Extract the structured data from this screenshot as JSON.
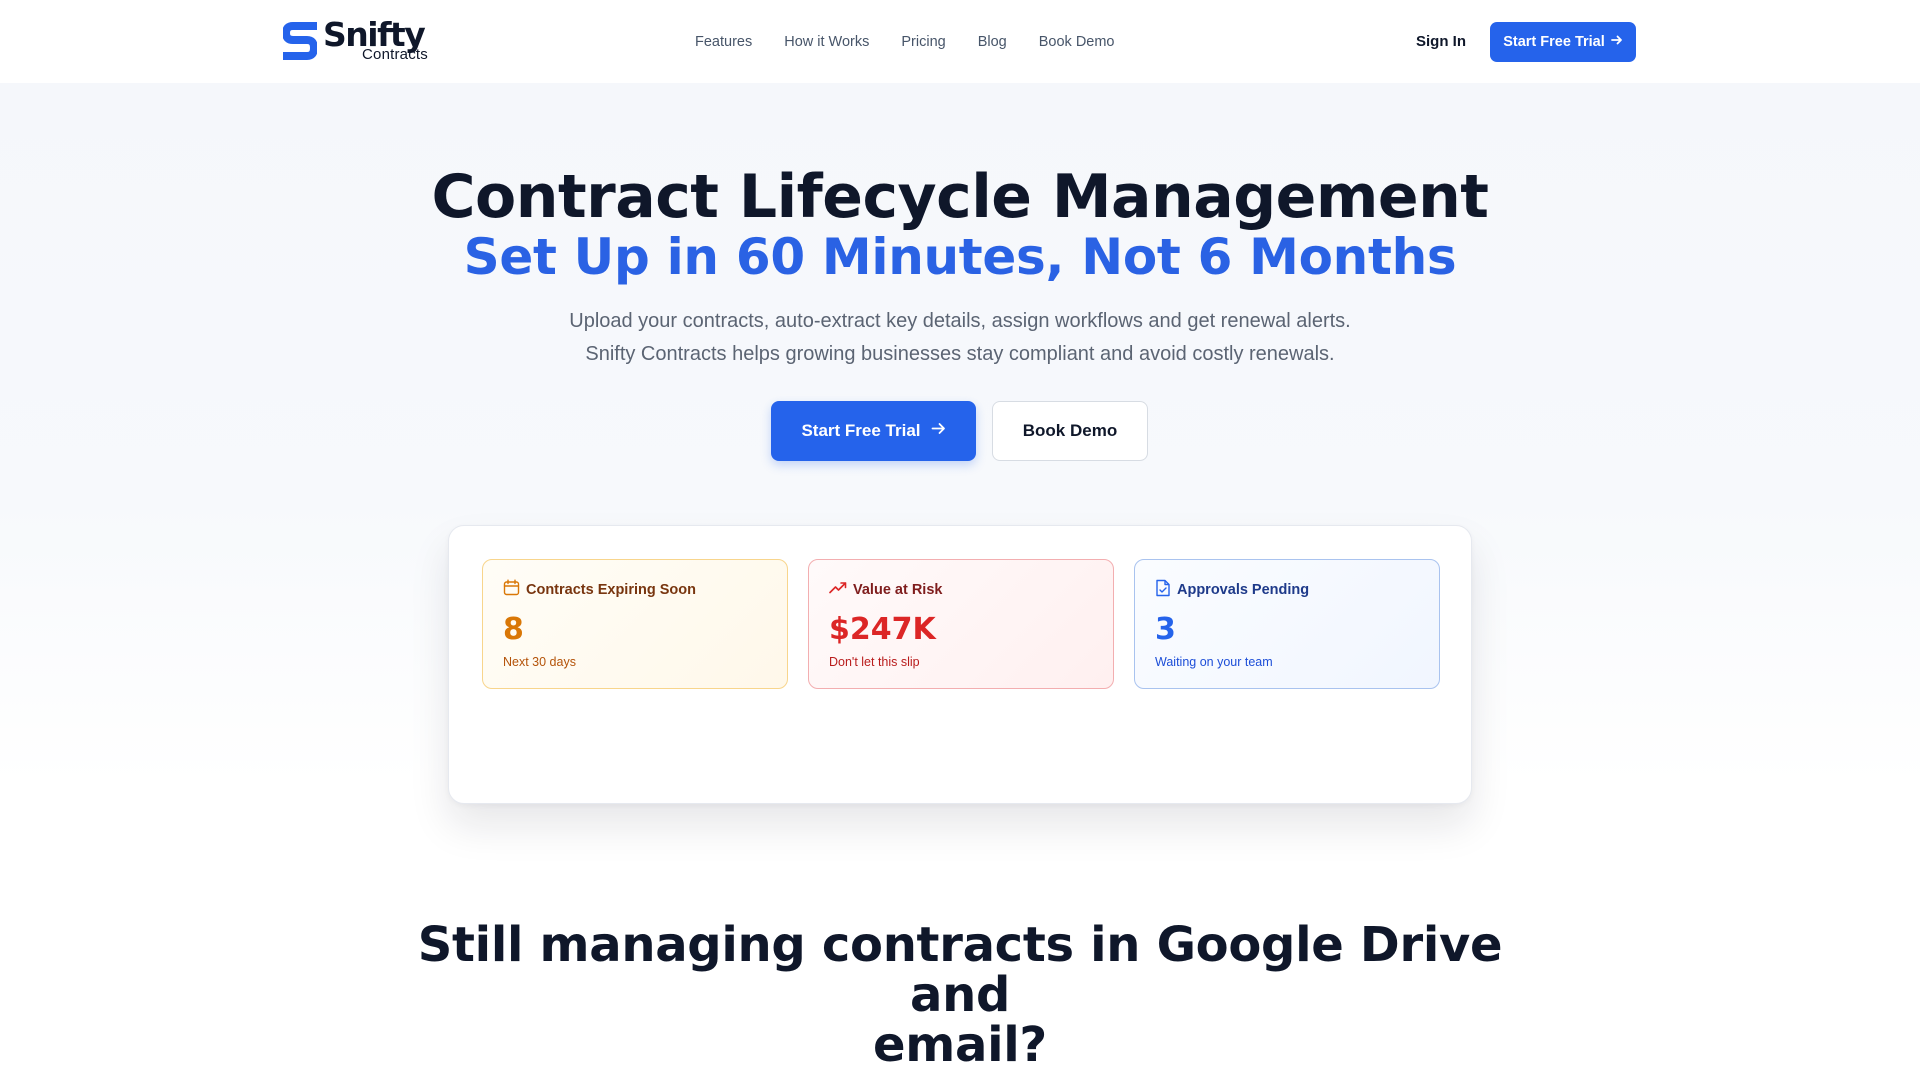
{
  "brand": {
    "name": "Snifty",
    "sub": "Contracts",
    "accent_color": "#2563eb",
    "logo_icon": "s-logo-icon"
  },
  "nav": {
    "items": [
      {
        "label": "Features"
      },
      {
        "label": "How it Works"
      },
      {
        "label": "Pricing"
      },
      {
        "label": "Blog"
      },
      {
        "label": "Book Demo"
      }
    ],
    "signin_label": "Sign In",
    "cta_label": "Start Free Trial",
    "cta_icon": "arrow-right-icon"
  },
  "hero": {
    "title": "Contract Lifecycle Management",
    "subtitle": "Set Up in 60 Minutes, Not 6 Months",
    "desc_line1": "Upload your contracts, auto-extract key details, assign workflows and get renewal alerts.",
    "desc_line2": "Snifty Contracts helps growing businesses stay compliant and avoid costly renewals.",
    "primary_label": "Start Free Trial",
    "secondary_label": "Book Demo"
  },
  "stats": [
    {
      "icon": "calendar-icon",
      "title": "Contracts Expiring Soon",
      "value": "8",
      "note": "Next 30 days",
      "color": "#d97706"
    },
    {
      "icon": "trending-up-icon",
      "title": "Value at Risk",
      "value": "$247K",
      "note": "Don't let this slip",
      "color": "#dc2626"
    },
    {
      "icon": "document-check-icon",
      "title": "Approvals Pending",
      "value": "3",
      "note": "Waiting on your team",
      "color": "#2563eb"
    }
  ],
  "section2": {
    "title_line1": "Still managing contracts in Google Drive and",
    "title_line2": "email?"
  }
}
